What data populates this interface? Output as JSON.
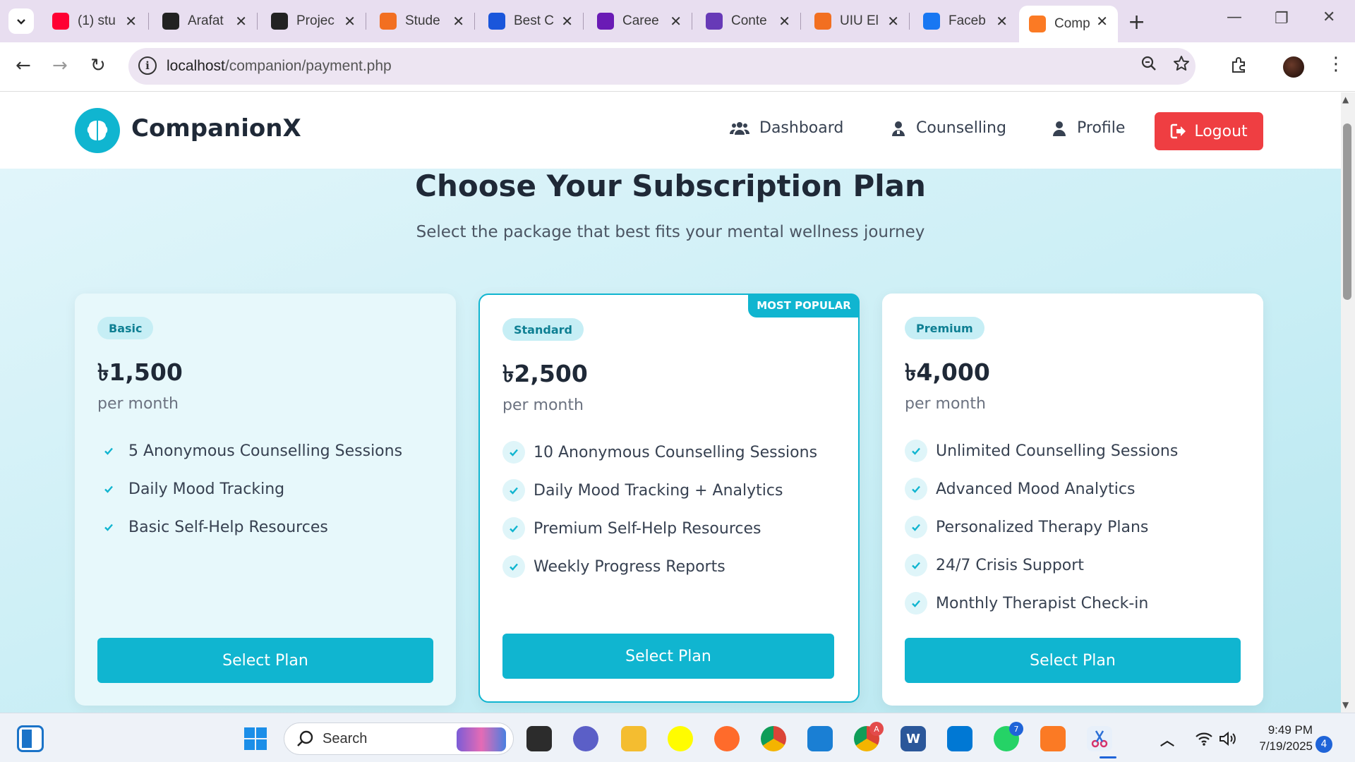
{
  "browser": {
    "tabs": [
      {
        "label": "(1) stu",
        "icon": "youtube-icon",
        "color": "#ff0033"
      },
      {
        "label": "Arafat",
        "icon": "chatgpt-icon",
        "color": "#222222"
      },
      {
        "label": "Projec",
        "icon": "chatgpt-icon",
        "color": "#222222"
      },
      {
        "label": "Stude",
        "icon": "uiu-icon",
        "color": "#f26f21"
      },
      {
        "label": "Best C",
        "icon": "bookmark-icon",
        "color": "#1a56db"
      },
      {
        "label": "Caree",
        "icon": "w-icon",
        "color": "#6a1bb5"
      },
      {
        "label": "Conte",
        "icon": "forms-icon",
        "color": "#673ab7"
      },
      {
        "label": "UIU El",
        "icon": "uiu-icon",
        "color": "#f26f21"
      },
      {
        "label": "Faceb",
        "icon": "facebook-icon",
        "color": "#1877f2"
      },
      {
        "label": "Comp",
        "icon": "xampp-icon",
        "color": "#fb7a24",
        "active": true
      }
    ],
    "url_host": "localhost",
    "url_path": "/companion/payment.php"
  },
  "site": {
    "brand": "CompanionX",
    "nav": {
      "dashboard": "Dashboard",
      "counselling": "Counselling",
      "profile": "Profile",
      "logout": "Logout"
    },
    "accent_color": "#10b5d0",
    "logout_color": "#ef3e42"
  },
  "main": {
    "title": "Choose Your Subscription Plan",
    "subtitle": "Select the package that best fits your mental wellness journey",
    "plans": [
      {
        "badge": "Basic",
        "price": "৳1,500",
        "period": "per month",
        "features": [
          "5 Anonymous Counselling Sessions",
          "Daily Mood Tracking",
          "Basic Self-Help Resources"
        ],
        "button": "Select Plan"
      },
      {
        "badge": "Standard",
        "ribbon": "MOST POPULAR",
        "price": "৳2,500",
        "period": "per month",
        "features": [
          "10 Anonymous Counselling Sessions",
          "Daily Mood Tracking + Analytics",
          "Premium Self-Help Resources",
          "Weekly Progress Reports"
        ],
        "button": "Select Plan"
      },
      {
        "badge": "Premium",
        "price": "৳4,000",
        "period": "per month",
        "features": [
          "Unlimited Counselling Sessions",
          "Advanced Mood Analytics",
          "Personalized Therapy Plans",
          "24/7 Crisis Support",
          "Monthly Therapist Check-in"
        ],
        "button": "Select Plan"
      }
    ]
  },
  "taskbar": {
    "search_label": "Search",
    "time": "9:49 PM",
    "date": "7/19/2025",
    "notifications": "4",
    "whatsapp_badge": "7",
    "chrome_badge": "A"
  }
}
